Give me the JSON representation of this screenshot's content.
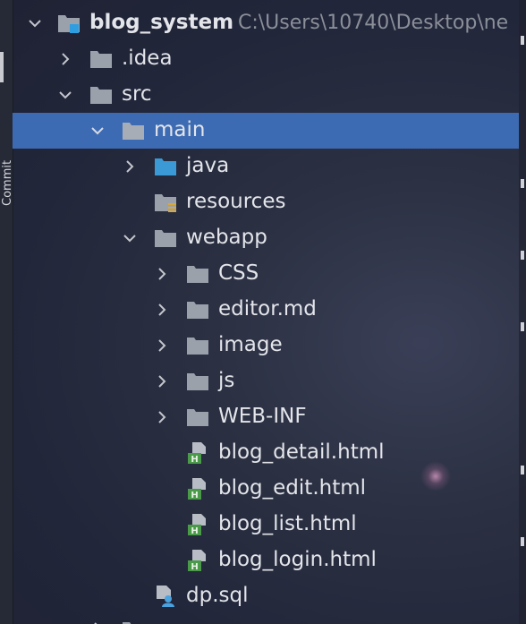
{
  "sidebar": {
    "tab_label": "Commit"
  },
  "project": {
    "name": "blog_system",
    "path": "C:\\Users\\10740\\Desktop\\ne"
  },
  "tree": {
    "idea": ".idea",
    "src": "src",
    "main": "main",
    "java": "java",
    "resources": "resources",
    "webapp": "webapp",
    "css": "CSS",
    "editor": "editor.md",
    "image": "image",
    "js": "js",
    "webinf": "WEB-INF",
    "files": [
      "blog_detail.html",
      "blog_edit.html",
      "blog_list.html",
      "blog_login.html"
    ],
    "sql": "dp.sql"
  },
  "colors": {
    "selection": "#3d6bb3",
    "folder": "#9aa1ab",
    "source_folder": "#3b9ad6",
    "html_icon": "#4a9a49"
  }
}
